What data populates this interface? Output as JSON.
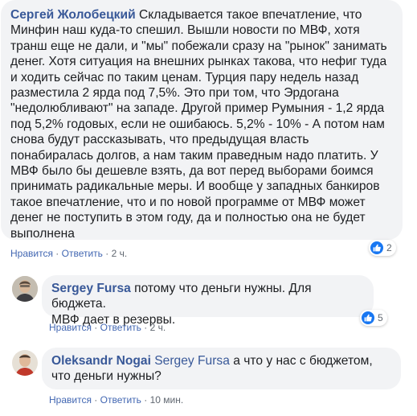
{
  "comments": [
    {
      "author": "Сергей Жолобецкий",
      "text": "Складывается такое впечатление, что\nМинфин наш куда-то спешил. Вышли новости по МВФ, хотя\nтранш еще не дали, и \"мы\" побежали сразу на \"рынок\" занимать\nденег. Хотя ситуация на внешних рынках такова, что нефиг туда\nи ходить сейчас по таким ценам. Турция пару недель назад\nразместила 2 ярда под 7,5%. Это при том, что Эрдогана\n\"недолюбливают\" на западе. Другой пример Румыния - 1,2 ярда\nпод 5,2% годовых, если не ошибаюсь. 5,2% - 10% - А потом нам\nснова будут рассказывать, что предыдущая власть\nпонабиралась долгов, а нам таким праведным надо платить. У\nМВФ было бы дешевле взять, да вот перед выборами боимся\nпринимать радикальные меры. И вообще у западных банкиров\nтакое впечатление, что и по новой программе от МВФ может\nденег не поступить в этом году, да и полностью она не будет\nвыполнена",
      "like_label": "Нравится",
      "reply_label": "Ответить",
      "time": "2 ч.",
      "reactions": "2"
    },
    {
      "author": "Sergey Fursa",
      "text": "потому что деньги нужны. Для бюджета.\nМВФ дает в резервы.",
      "like_label": "Нравится",
      "reply_label": "Ответить",
      "time": "2 ч.",
      "reactions": "5"
    },
    {
      "author": "Oleksandr Nogai",
      "mention": "Sergey Fursa",
      "text": "а что у нас с бюджетом,\nчто деньги нужны?",
      "like_label": "Нравится",
      "reply_label": "Ответить",
      "time": "10 мин."
    }
  ],
  "separator": "·",
  "icons": {
    "like": "thumbs-up-icon",
    "link_color": "#385898",
    "like_badge_color": "#1877f2"
  }
}
